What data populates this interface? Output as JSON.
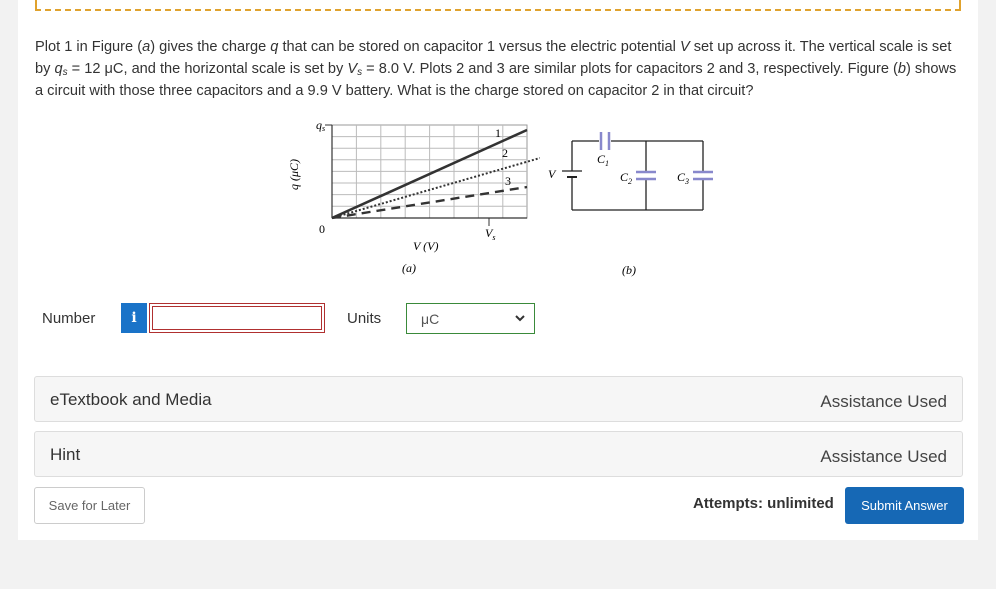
{
  "question": {
    "p1": "Plot 1 in Figure (",
    "fig_a": "a",
    "p2": ") gives the charge ",
    "q": "q",
    "p3": " that can be stored on capacitor 1 versus the electric potential ",
    "V": "V",
    "p4": " set up across it. The vertical scale is set by ",
    "qs_var": "q",
    "qs_sub": "s",
    "p5": " = 12 μC, and the horizontal scale is set by ",
    "Vs_var": "V",
    "Vs_sub": "s",
    "p6": " = 8.0 V. Plots 2 and 3 are similar plots for capacitors 2 and 3, respectively. Figure (",
    "fig_b": "b",
    "p7": ") shows a circuit with those three capacitors and a 9.9 V battery. What is the charge stored on capacitor 2 in that circuit?"
  },
  "figure_a": {
    "y_axis_label": "q (μC)",
    "qs_label": "q",
    "qs_sub": "s",
    "zero_label": "0",
    "x_axis_label": "V (V)",
    "vs_label": "V",
    "vs_sub": "s",
    "plot_labels": [
      "1",
      "2",
      "3"
    ],
    "caption": "(a)"
  },
  "figure_b": {
    "battery_label": "V",
    "c1": "C",
    "c1_sub": "1",
    "c2": "C",
    "c2_sub": "2",
    "c3": "C",
    "c3_sub": "3",
    "caption": "(b)"
  },
  "answer": {
    "number_label": "Number",
    "info_icon": "i",
    "number_value": "",
    "units_label": "Units",
    "units_selected": "μC"
  },
  "panels": {
    "etextbook_title": "eTextbook and Media",
    "etextbook_status": "Assistance Used",
    "hint_title": "Hint",
    "hint_status": "Assistance Used"
  },
  "footer": {
    "save_label": "Save for Later",
    "attempts_text": "Attempts: unlimited",
    "submit_label": "Submit Answer"
  },
  "colors": {
    "submit": "#1668b5",
    "info": "#1a73c8",
    "capacitor": "#8888cc",
    "input_border": "#b03030",
    "select_border": "#3a8a3a"
  }
}
